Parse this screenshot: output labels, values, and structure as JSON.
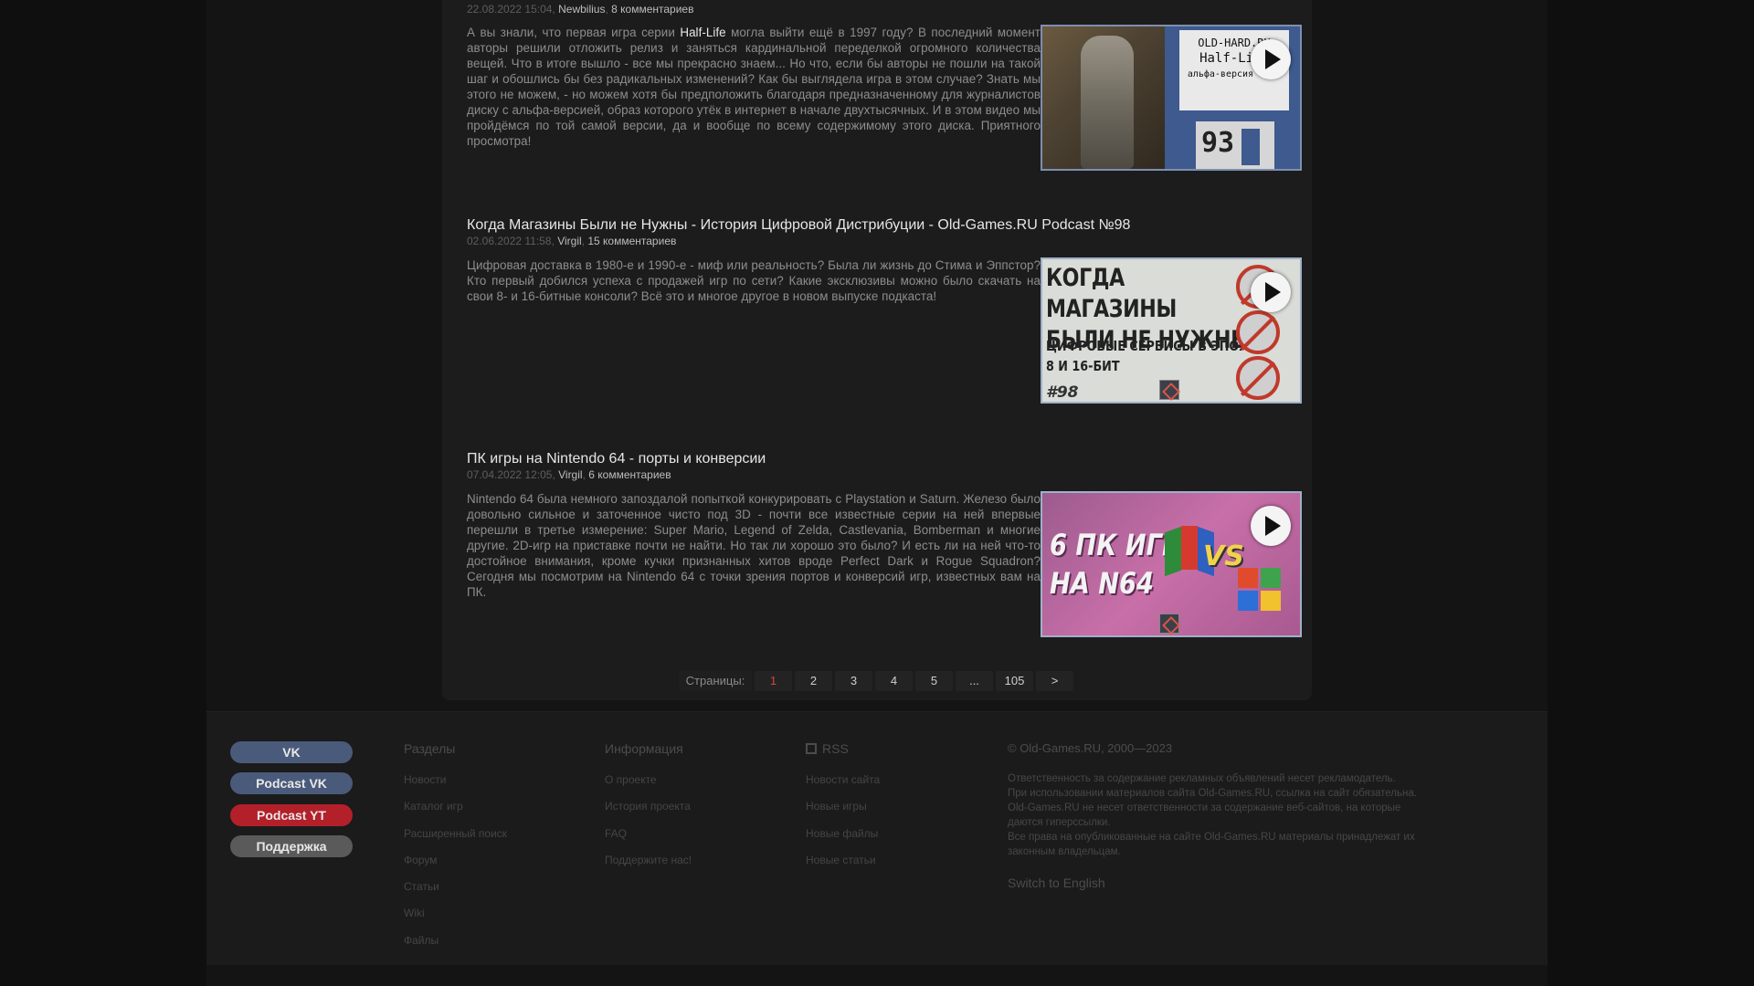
{
  "articles": [
    {
      "title": "",
      "date": "22.08.2022 15:04,",
      "author": "Newbilius",
      "comments": "8 комментариев",
      "text_before": "А вы знали, что первая игра серии ",
      "text_highlight": "Half-Life",
      "text_after": " могла выйти ещё в 1997 году? В последний момент авторы решили отложить релиз и заняться кардинальной переделкой огромного количества вещей. Что в итоге вышло - все мы прекрасно знаем... Но что, если бы авторы не пошли на такой шаг и обошлись бы без радикальных изменений? Как бы выглядела игра в этом случае? Знать мы этого не можем, - но можем хотя бы предположить благодаря предназначенному для журналистов диску с альфа-версией, образ которого утёк в интернет в начале двухтысячных. И в этом видео мы пройдёмся по той самой версии, да и вообще по всему содержимому этого диска. Приятного просмотра!",
      "thumb": {
        "label_line1": "OLD-HARD.RU",
        "label_line2": "Half-Life",
        "label_line3": "альфа-версия 0.52",
        "disk_number": "93"
      }
    },
    {
      "title": "Когда Магазины Были не Нужны - История Цифровой Дистрибуции - Old-Games.RU Podcast №98",
      "date": "02.06.2022 11:58,",
      "author": "Virgil",
      "comments": "15 комментариев",
      "text": "Цифровая доставка в 1980-е и 1990-е - миф или реальность? Была ли жизнь до Стима и Эппстор? Кто первый добился успеха с продажей игр по сети? Какие эксклюзивы можно было скачать на свои 8- и 16-битные консоли? Всё это и многое другое в новом выпуске подкаста!",
      "thumb": {
        "heading_line1": "КОГДА МАГАЗИНЫ",
        "heading_line2": "БЫЛИ НЕ НУЖНЫ",
        "sub_line1": "ЦИФРОВЫЕ СЕРВИСЫ В ЭПОХУ",
        "sub_line2": "8 И 16-БИТ",
        "episode": "#98"
      }
    },
    {
      "title": "ПК игры на Nintendo 64 - порты и конверсии",
      "date": "07.04.2022 12:05,",
      "author": "Virgil",
      "comments": "6 комментариев",
      "text": "Nintendo 64 была немного запоздалой попыткой конкурировать с Playstation и Saturn. Железо было довольно сильное и заточенное чисто под 3D - почти все известные серии на ней впервые перешли в третье измерение: Super Mario, Legend of Zelda, Castlevania, Bomberman и многие другие. 2D-игр на приставке почти не найти. Но так ли хорошо это было? И есть ли на ней что-то достойное внимания, кроме кучки признанных хитов вроде Perfect Dark и Rogue Squadron? Сегодня мы посмотрим на Nintendo 64 с точки зрения портов и конверсий игр, известных вам на ПК.",
      "thumb": {
        "heading_line1": "6 ПК ИГР",
        "heading_line2": "НА  N64",
        "vs": "VS"
      }
    }
  ],
  "pagination": {
    "label": "Страницы:",
    "pages": [
      "1",
      "2",
      "3",
      "4",
      "5"
    ],
    "ellipsis": "...",
    "last": "105",
    "next": ">",
    "active_color": "#d9443a"
  },
  "footer": {
    "buttons": [
      {
        "label": "VK",
        "color": "#4a5a7a"
      },
      {
        "label": "Podcast VK",
        "color": "#4a5a7a"
      },
      {
        "label": "Podcast YT",
        "color": "#b3202a"
      },
      {
        "label": "Поддержка",
        "color": "#5a5a5a"
      }
    ],
    "sections": {
      "heading": "Разделы",
      "items": [
        "Новости",
        "Каталог игр",
        "Расширенный поиск",
        "Форум",
        "Статьи",
        "Wiki",
        "Файлы"
      ]
    },
    "info": {
      "heading": "Информация",
      "items": [
        "О проекте",
        "История проекта",
        "FAQ",
        "Поддержите нас!"
      ]
    },
    "rss": {
      "heading": "RSS",
      "items": [
        "Новости сайта",
        "Новые игры",
        "Новые файлы",
        "Новые статьи"
      ]
    },
    "copyright": {
      "heading": "© Old-Games.RU, 2000—2023",
      "lines": [
        "Ответственность за содержание рекламных объявлений несет рекламодатель.",
        "При использовании материалов сайта Old-Games.RU, ссылка на сайт обязательна.",
        "Old-Games.RU не несет ответственности за содержание веб-сайтов, на которые",
        "даются гиперссылки.",
        "Все права на опубликованные на сайте Old-Games.RU материалы принадлежат их",
        "законным владельцам."
      ],
      "switch_lang": "Switch to English"
    }
  }
}
